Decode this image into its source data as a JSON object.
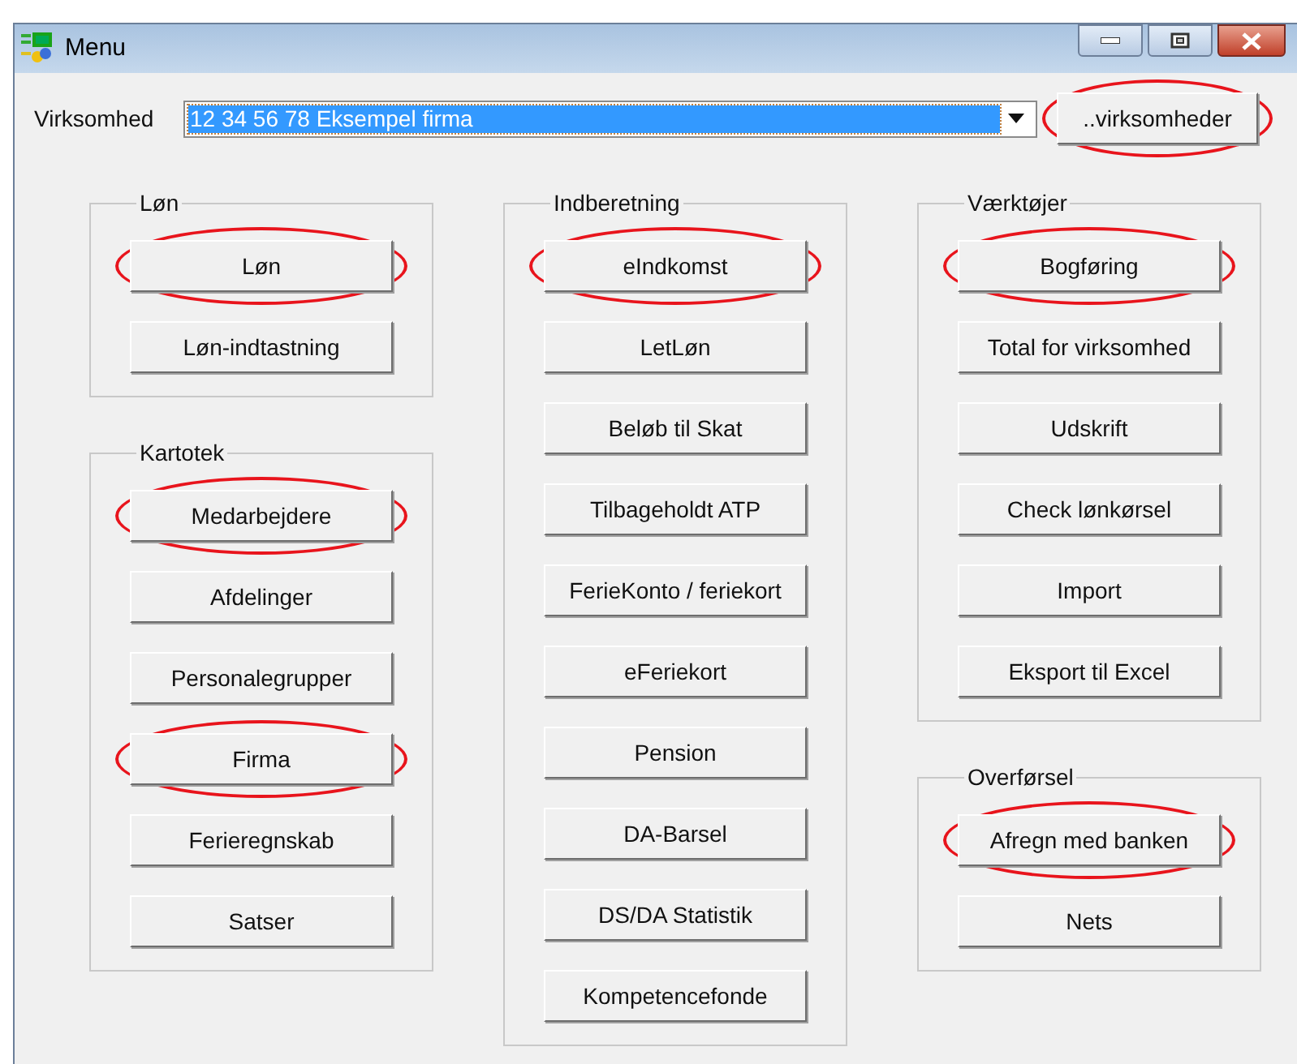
{
  "window": {
    "title": "Menu"
  },
  "company": {
    "label": "Virksomhed",
    "value": "12 34 56 78  Eksempel firma",
    "button": {
      "label": "..virksomheder",
      "highlighted": true
    }
  },
  "columns": [
    {
      "groups": [
        {
          "title": "Løn",
          "buttons": [
            {
              "label": "Løn",
              "highlighted": true
            },
            {
              "label": "Løn-indtastning",
              "highlighted": false
            }
          ]
        },
        {
          "title": "Kartotek",
          "buttons": [
            {
              "label": "Medarbejdere",
              "highlighted": true
            },
            {
              "label": "Afdelinger",
              "highlighted": false
            },
            {
              "label": "Personalegrupper",
              "highlighted": false
            },
            {
              "label": "Firma",
              "highlighted": true
            },
            {
              "label": "Ferieregnskab",
              "highlighted": false
            },
            {
              "label": "Satser",
              "highlighted": false
            }
          ]
        }
      ]
    },
    {
      "groups": [
        {
          "title": "Indberetning",
          "buttons": [
            {
              "label": "eIndkomst",
              "highlighted": true
            },
            {
              "label": "LetLøn",
              "highlighted": false
            },
            {
              "label": "Beløb til Skat",
              "highlighted": false
            },
            {
              "label": "Tilbageholdt ATP",
              "highlighted": false
            },
            {
              "label": "FerieKonto / feriekort",
              "highlighted": false
            },
            {
              "label": "eFeriekort",
              "highlighted": false
            },
            {
              "label": "Pension",
              "highlighted": false
            },
            {
              "label": "DA-Barsel",
              "highlighted": false
            },
            {
              "label": "DS/DA Statistik",
              "highlighted": false
            },
            {
              "label": "Kompetencefonde",
              "highlighted": false
            }
          ]
        }
      ]
    },
    {
      "groups": [
        {
          "title": "Værktøjer",
          "buttons": [
            {
              "label": "Bogføring",
              "highlighted": true
            },
            {
              "label": "Total for virksomhed",
              "highlighted": false
            },
            {
              "label": "Udskrift",
              "highlighted": false
            },
            {
              "label": "Check lønkørsel",
              "highlighted": false
            },
            {
              "label": "Import",
              "highlighted": false
            },
            {
              "label": "Eksport til Excel",
              "highlighted": false
            }
          ]
        },
        {
          "title": "Overførsel",
          "buttons": [
            {
              "label": "Afregn med banken",
              "highlighted": true
            },
            {
              "label": "Nets",
              "highlighted": false
            }
          ]
        }
      ]
    }
  ]
}
